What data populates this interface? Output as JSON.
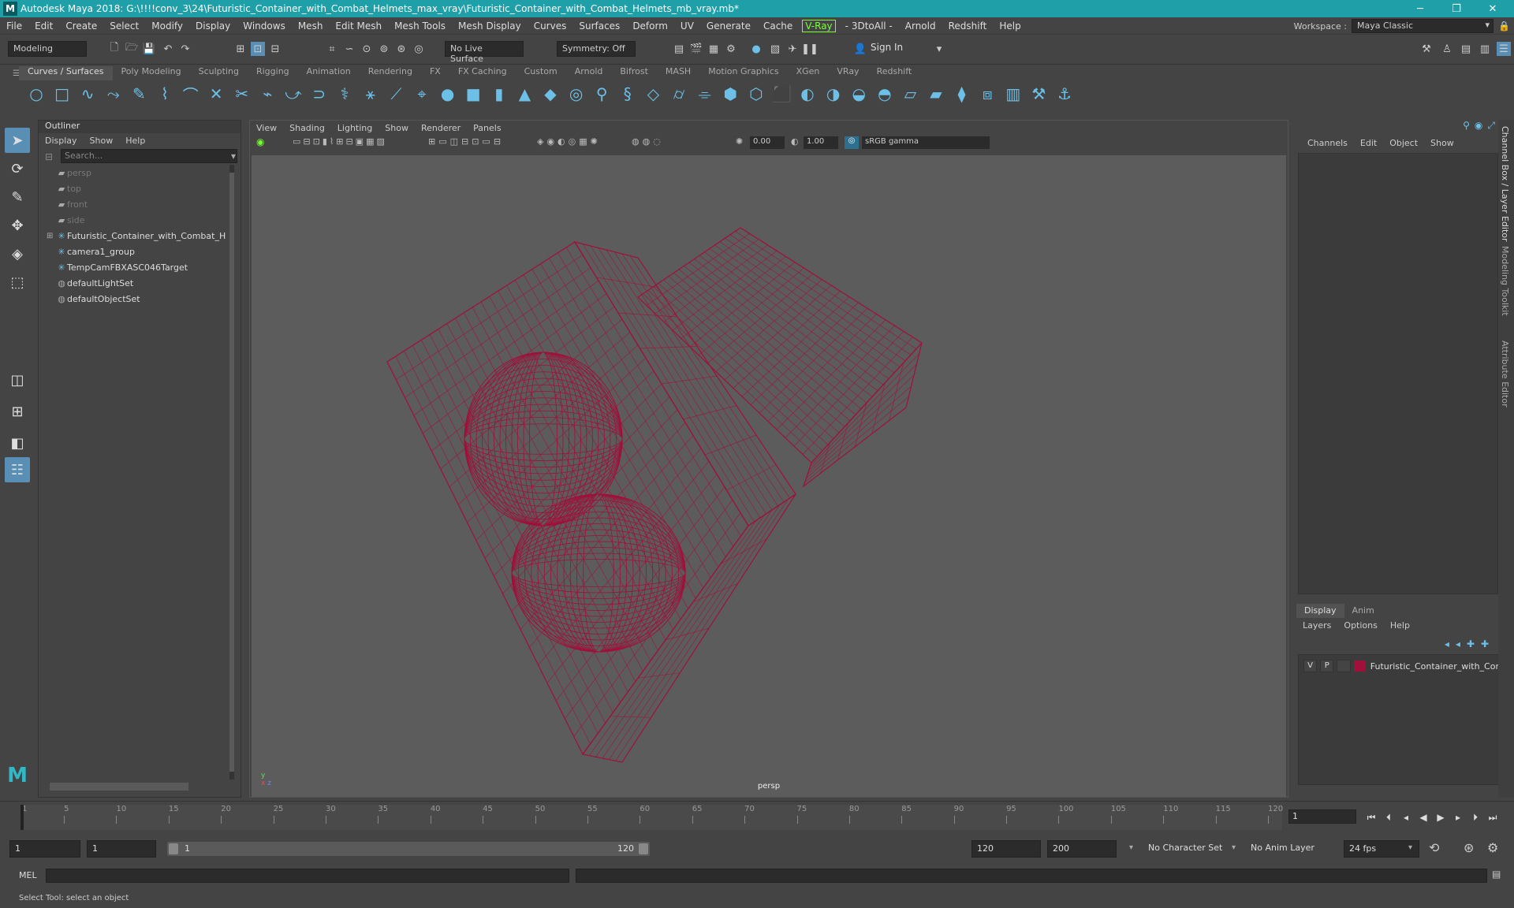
{
  "window": {
    "title": "Autodesk Maya 2018: G:\\!!!!conv_3\\24\\Futuristic_Container_with_Combat_Helmets_max_vray\\Futuristic_Container_with_Combat_Helmets_mb_vray.mb*",
    "minimize": "─",
    "maximize": "❐",
    "close": "✕",
    "logo": "M"
  },
  "menubar": [
    "File",
    "Edit",
    "Create",
    "Select",
    "Modify",
    "Display",
    "Windows",
    "Mesh",
    "Edit Mesh",
    "Mesh Tools",
    "Mesh Display",
    "Curves",
    "Surfaces",
    "Deform",
    "UV",
    "Generate",
    "Cache",
    "V-Ray",
    "- 3DtoAll -",
    "Arnold",
    "Redshift",
    "Help"
  ],
  "workspace": {
    "label": "Workspace :",
    "value": "Maya Classic"
  },
  "statusline": {
    "mode": "Modeling",
    "live_surface": "No Live Surface",
    "symmetry": "Symmetry: Off",
    "sign_in": "Sign In"
  },
  "shelf": {
    "tabs": [
      "Curves / Surfaces",
      "Poly Modeling",
      "Sculpting",
      "Rigging",
      "Animation",
      "Rendering",
      "FX",
      "FX Caching",
      "Custom",
      "Arnold",
      "Bifrost",
      "MASH",
      "Motion Graphics",
      "XGen",
      "VRay",
      "Redshift"
    ],
    "active": "Curves / Surfaces"
  },
  "outliner": {
    "title": "Outliner",
    "menu": [
      "Display",
      "Show",
      "Help"
    ],
    "search_placeholder": "Search...",
    "items": [
      {
        "label": "persp",
        "icon": "camera-icon",
        "dim": true
      },
      {
        "label": "top",
        "icon": "camera-icon",
        "dim": true
      },
      {
        "label": "front",
        "icon": "camera-icon",
        "dim": true
      },
      {
        "label": "side",
        "icon": "camera-icon",
        "dim": true
      },
      {
        "label": "Futuristic_Container_with_Combat_H",
        "icon": "group-icon",
        "dim": false,
        "expandable": true
      },
      {
        "label": "camera1_group",
        "icon": "group-icon",
        "dim": false
      },
      {
        "label": "TempCamFBXASC046Target",
        "icon": "locator-icon",
        "dim": false
      },
      {
        "label": "defaultLightSet",
        "icon": "set-icon",
        "dim": false
      },
      {
        "label": "defaultObjectSet",
        "icon": "set-icon",
        "dim": false
      }
    ]
  },
  "viewport": {
    "menu": [
      "View",
      "Shading",
      "Lighting",
      "Show",
      "Renderer",
      "Panels"
    ],
    "exposure": "0.00",
    "gamma": "1.00",
    "color_space": "sRGB gamma",
    "camera": "persp",
    "wire_color": "#a0103a"
  },
  "channelbox": {
    "menu": [
      "Channels",
      "Edit",
      "Object",
      "Show"
    ]
  },
  "layer_editor": {
    "tabs": [
      "Display",
      "Anim"
    ],
    "active_tab": "Display",
    "menu": [
      "Layers",
      "Options",
      "Help"
    ],
    "layers": [
      {
        "v": "V",
        "p": "P",
        "name": "Futuristic_Container_with_Cor",
        "color": "#a0103a"
      }
    ]
  },
  "side_tabs": [
    "Channel Box / Layer Editor",
    "Modeling Toolkit",
    "Attribute Editor"
  ],
  "timeline": {
    "ticks": [
      "1",
      "5",
      "10",
      "15",
      "20",
      "25",
      "30",
      "35",
      "40",
      "45",
      "50",
      "55",
      "60",
      "65",
      "70",
      "75",
      "80",
      "85",
      "90",
      "95",
      "100",
      "105",
      "110",
      "115",
      "120"
    ],
    "current_frame": "1"
  },
  "range": {
    "start": "1",
    "playback_start": "1",
    "slider_start": "1",
    "slider_end": "120",
    "playback_end": "120",
    "end": "200",
    "character_set": "No Character Set",
    "anim_layer": "No Anim Layer",
    "fps": "24 fps"
  },
  "cmdline": {
    "lang": "MEL"
  },
  "helpline": "Select Tool: select an object"
}
